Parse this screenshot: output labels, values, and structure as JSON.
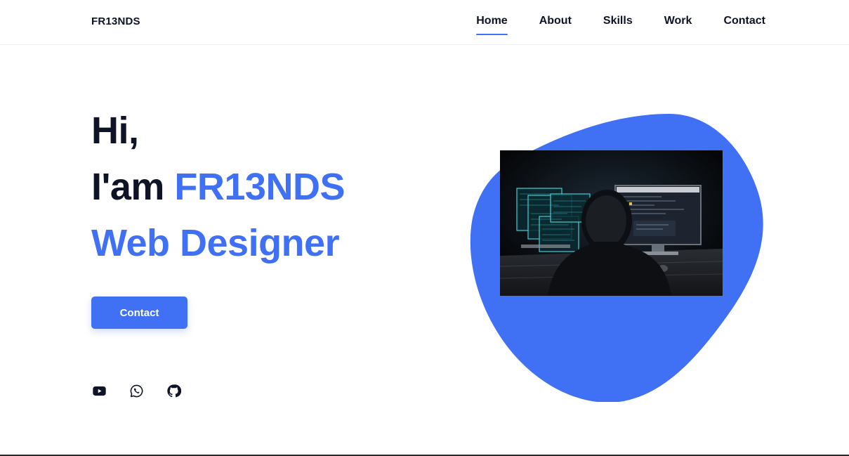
{
  "header": {
    "logo": "FR13NDS",
    "nav": [
      {
        "label": "Home",
        "active": true
      },
      {
        "label": "About",
        "active": false
      },
      {
        "label": "Skills",
        "active": false
      },
      {
        "label": "Work",
        "active": false
      },
      {
        "label": "Contact",
        "active": false
      }
    ]
  },
  "hero": {
    "greeting": "Hi,",
    "intro_prefix": "I'am",
    "name": "FR13NDS",
    "role": "Web Designer",
    "button_label": "Contact"
  },
  "social": [
    {
      "icon": "youtube-icon"
    },
    {
      "icon": "whatsapp-icon"
    },
    {
      "icon": "github-icon"
    }
  ],
  "colors": {
    "accent": "#4070f4",
    "text": "#0e1326",
    "background": "#ffffff"
  }
}
